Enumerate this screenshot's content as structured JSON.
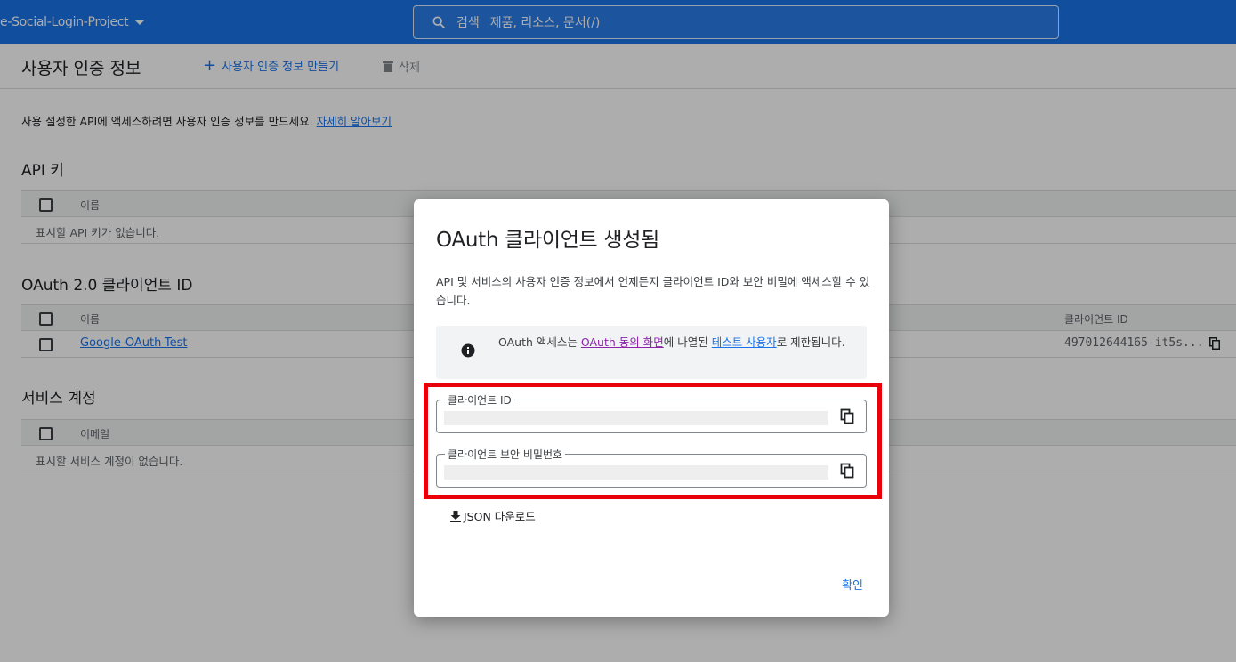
{
  "topbar": {
    "project_name": "e-Social-Login-Project",
    "search_label": "검색",
    "search_placeholder": "제품, 리소스, 문서(/)"
  },
  "page": {
    "title": "사용자 인증 정보",
    "create_label": "사용자 인증 정보 만들기",
    "delete_label": "삭제",
    "intro_text": "사용 설정한 API에 액세스하려면 사용자 인증 정보를 만드세요.",
    "intro_link": "자세히 알아보기"
  },
  "api_keys": {
    "title": "API 키",
    "col_name": "이름",
    "empty_text": "표시할 API 키가 없습니다."
  },
  "oauth_clients": {
    "title": "OAuth 2.0 클라이언트 ID",
    "col_name": "이름",
    "col_client_id": "클라이언트 ID",
    "rows": [
      {
        "name": "Google-OAuth-Test",
        "client_id": "497012644165-it5s..."
      }
    ]
  },
  "service_accounts": {
    "title": "서비스 계정",
    "col_email": "이메일",
    "empty_text": "표시할 서비스 계정이 없습니다."
  },
  "dialog": {
    "title": "OAuth 클라이언트 생성됨",
    "description": "API 및 서비스의 사용자 인증 정보에서 언제든지 클라이언트 ID와 보안 비밀에 액세스할 수 있습니다.",
    "info_part1": "OAuth 액세스는 ",
    "info_link1": "OAuth 동의 화면",
    "info_part2": "에 나열된 ",
    "info_link2": "테스트 사용자",
    "info_part3": "로 제한됩니다.",
    "client_id_label": "클라이언트 ID",
    "client_secret_label": "클라이언트 보안 비밀번호",
    "json_download_label": "JSON 다운로드",
    "ok_label": "확인"
  },
  "colors": {
    "brand_blue": "#1a73e8",
    "highlight_red": "#e8000b",
    "visited_link": "#8e24aa"
  },
  "icons": [
    "search-icon",
    "chevron-down-icon",
    "plus-icon",
    "trash-icon",
    "info-icon",
    "copy-icon",
    "download-icon"
  ]
}
